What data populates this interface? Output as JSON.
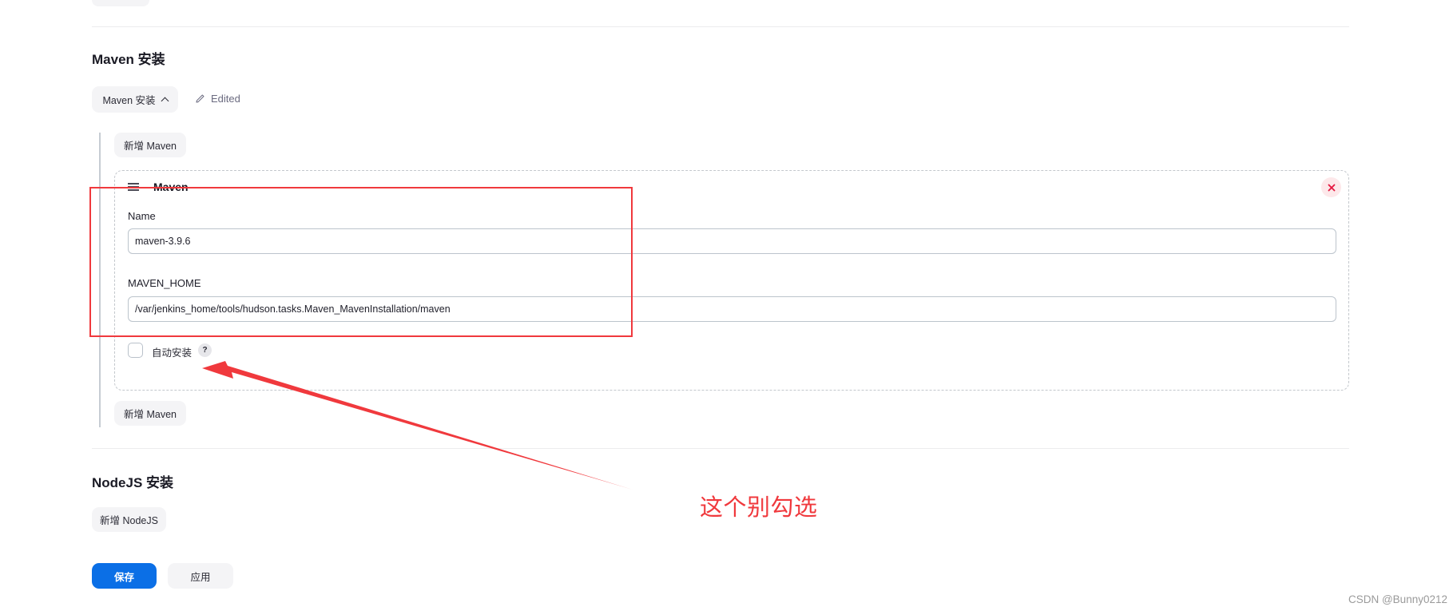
{
  "maven_section": {
    "title": "Maven 安装",
    "dropdown_label": "Maven 安装",
    "edited_label": "Edited",
    "add_button_top": "新增 Maven",
    "add_button_bottom": "新增 Maven",
    "installation": {
      "title": "Maven",
      "name_label": "Name",
      "name_value": "maven-3.9.6",
      "home_label": "MAVEN_HOME",
      "home_value": "/var/jenkins_home/tools/hudson.tasks.Maven_MavenInstallation/maven",
      "auto_install_label": "自动安装",
      "auto_install_checked": false,
      "help_label": "?"
    }
  },
  "nodejs_section": {
    "title": "NodeJS 安装",
    "add_button": "新增 NodeJS"
  },
  "actions": {
    "save_label": "保存",
    "apply_label": "应用"
  },
  "annotation": {
    "text": "这个别勾选",
    "color": "#f0393d"
  },
  "watermark": "CSDN @Bunny0212",
  "colors": {
    "primary": "#0b6fe6",
    "danger": "#e5173f",
    "button_bg": "#f4f4f6"
  }
}
